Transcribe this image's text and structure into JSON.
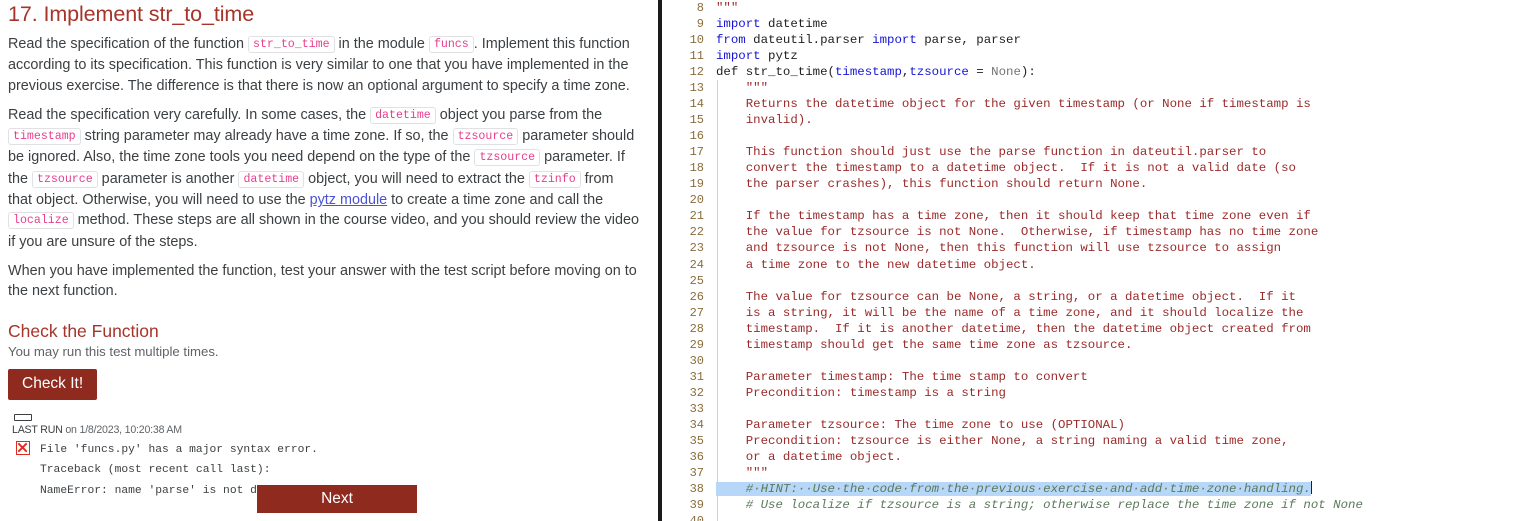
{
  "exercise": {
    "title": "17. Implement str_to_time",
    "paragraphs": [
      {
        "id": "p1",
        "runs": [
          {
            "t": "text",
            "v": "Read the specification of the function "
          },
          {
            "t": "code",
            "v": "str_to_time"
          },
          {
            "t": "text",
            "v": " in the module "
          },
          {
            "t": "code",
            "v": "funcs"
          },
          {
            "t": "text",
            "v": ". Implement this function according to its specification. This function is very similar to one that you have implemented in the previous exercise. The difference is that there is now an optional argument to specify a time zone."
          }
        ]
      },
      {
        "id": "p2",
        "runs": [
          {
            "t": "text",
            "v": "Read the specification very carefully. In some cases, the "
          },
          {
            "t": "code",
            "v": "datetime"
          },
          {
            "t": "text",
            "v": " object you parse from the "
          },
          {
            "t": "code",
            "v": "timestamp"
          },
          {
            "t": "text",
            "v": " string parameter may already have a time zone. If so, the "
          },
          {
            "t": "code",
            "v": "tzsource"
          },
          {
            "t": "text",
            "v": " parameter should be ignored. Also, the time zone tools you need depend on the type of the "
          },
          {
            "t": "code",
            "v": "tzsource"
          },
          {
            "t": "text",
            "v": " parameter. If the "
          },
          {
            "t": "code",
            "v": "tzsource"
          },
          {
            "t": "text",
            "v": " parameter is another "
          },
          {
            "t": "code",
            "v": "datetime"
          },
          {
            "t": "text",
            "v": " object, you will need to extract the "
          },
          {
            "t": "code",
            "v": "tzinfo"
          },
          {
            "t": "text",
            "v": " from that object. Otherwise, you will need to use the "
          },
          {
            "t": "link",
            "v": "pytz module"
          },
          {
            "t": "text",
            "v": " to create a time zone and call the "
          },
          {
            "t": "code",
            "v": "localize"
          },
          {
            "t": "text",
            "v": " method. These steps are all shown in the course video, and you should review the video if you are unsure of the steps."
          }
        ]
      },
      {
        "id": "p3",
        "runs": [
          {
            "t": "text",
            "v": "When you have implemented the function, test your answer with the test script before moving on to the next function."
          }
        ]
      }
    ]
  },
  "check_section": {
    "heading": "Check the Function",
    "subtitle": "You may run this test multiple times.",
    "button_label": "Check It!",
    "last_run_label": "LAST RUN",
    "last_run_on": "on",
    "last_run_timestamp": "1/8/2023, 10:20:38 AM",
    "status_icon": "error-x-icon",
    "result_lines": [
      "File 'funcs.py' has a major syntax error.",
      "Traceback (most recent call last):",
      "NameError: name 'parse' is not defined"
    ]
  },
  "footer": {
    "next_label": "Next"
  },
  "colors": {
    "brand_red": "#a6342a",
    "button_red": "#8f2a1e",
    "link_blue": "#4a52d6",
    "inline_code_pink": "#e83e8c",
    "error_red": "#e02b20",
    "selection_blue": "#b6d7f7",
    "gutter_number": "#8a6d3b",
    "keyword_blue": "#1515d6",
    "docstring_red": "#9b2a2a",
    "comment_green": "#5c7a5c"
  },
  "editor": {
    "first_visible_line": 8,
    "selected_line": 38,
    "lines": [
      {
        "n": 8,
        "indent": false,
        "tokens": [
          {
            "c": "tok-doc",
            "v": "\"\"\""
          }
        ]
      },
      {
        "n": 9,
        "indent": false,
        "tokens": [
          {
            "c": "tok-kw",
            "v": "import"
          },
          {
            "c": "tok-plain",
            "v": " datetime"
          }
        ]
      },
      {
        "n": 10,
        "indent": false,
        "tokens": [
          {
            "c": "tok-kw",
            "v": "from"
          },
          {
            "c": "tok-plain",
            "v": " dateutil.parser "
          },
          {
            "c": "tok-kw",
            "v": "import"
          },
          {
            "c": "tok-plain",
            "v": " parse, parser"
          }
        ]
      },
      {
        "n": 11,
        "indent": false,
        "tokens": [
          {
            "c": "tok-kw",
            "v": "import"
          },
          {
            "c": "tok-plain",
            "v": " pytz"
          }
        ]
      },
      {
        "n": 12,
        "indent": false,
        "tokens": [
          {
            "c": "tok-plain",
            "v": "def str_to_time("
          },
          {
            "c": "tok-var",
            "v": "timestamp"
          },
          {
            "c": "tok-plain",
            "v": ","
          },
          {
            "c": "tok-var",
            "v": "tzsource"
          },
          {
            "c": "tok-plain",
            "v": " = "
          },
          {
            "c": "tok-none",
            "v": "None"
          },
          {
            "c": "tok-plain",
            "v": "):"
          }
        ]
      },
      {
        "n": 13,
        "indent": true,
        "tokens": [
          {
            "c": "tok-doc",
            "v": "    \"\"\""
          }
        ]
      },
      {
        "n": 14,
        "indent": true,
        "tokens": [
          {
            "c": "tok-doc",
            "v": "    Returns the datetime object for the given timestamp (or None if timestamp is"
          }
        ]
      },
      {
        "n": 15,
        "indent": true,
        "tokens": [
          {
            "c": "tok-doc",
            "v": "    invalid)."
          }
        ]
      },
      {
        "n": 16,
        "indent": true,
        "tokens": [
          {
            "c": "tok-doc",
            "v": ""
          }
        ]
      },
      {
        "n": 17,
        "indent": true,
        "tokens": [
          {
            "c": "tok-doc",
            "v": "    This function should just use the parse function in dateutil.parser to"
          }
        ]
      },
      {
        "n": 18,
        "indent": true,
        "tokens": [
          {
            "c": "tok-doc",
            "v": "    convert the timestamp to a datetime object.  If it is not a valid date (so"
          }
        ]
      },
      {
        "n": 19,
        "indent": true,
        "tokens": [
          {
            "c": "tok-doc",
            "v": "    the parser crashes), this function should return None."
          }
        ]
      },
      {
        "n": 20,
        "indent": true,
        "tokens": [
          {
            "c": "tok-doc",
            "v": ""
          }
        ]
      },
      {
        "n": 21,
        "indent": true,
        "tokens": [
          {
            "c": "tok-doc",
            "v": "    If the timestamp has a time zone, then it should keep that time zone even if"
          }
        ]
      },
      {
        "n": 22,
        "indent": true,
        "tokens": [
          {
            "c": "tok-doc",
            "v": "    the value for tzsource is not None.  Otherwise, if timestamp has no time zone"
          }
        ]
      },
      {
        "n": 23,
        "indent": true,
        "tokens": [
          {
            "c": "tok-doc",
            "v": "    and tzsource is not None, then this function will use tzsource to assign"
          }
        ]
      },
      {
        "n": 24,
        "indent": true,
        "tokens": [
          {
            "c": "tok-doc",
            "v": "    a time zone to the new datetime object."
          }
        ]
      },
      {
        "n": 25,
        "indent": true,
        "tokens": [
          {
            "c": "tok-doc",
            "v": ""
          }
        ]
      },
      {
        "n": 26,
        "indent": true,
        "tokens": [
          {
            "c": "tok-doc",
            "v": "    The value for tzsource can be None, a string, or a datetime object.  If it"
          }
        ]
      },
      {
        "n": 27,
        "indent": true,
        "tokens": [
          {
            "c": "tok-doc",
            "v": "    is a string, it will be the name of a time zone, and it should localize the"
          }
        ]
      },
      {
        "n": 28,
        "indent": true,
        "tokens": [
          {
            "c": "tok-doc",
            "v": "    timestamp.  If it is another datetime, then the datetime object created from"
          }
        ]
      },
      {
        "n": 29,
        "indent": true,
        "tokens": [
          {
            "c": "tok-doc",
            "v": "    timestamp should get the same time zone as tzsource."
          }
        ]
      },
      {
        "n": 30,
        "indent": true,
        "tokens": [
          {
            "c": "tok-doc",
            "v": ""
          }
        ]
      },
      {
        "n": 31,
        "indent": true,
        "tokens": [
          {
            "c": "tok-doc",
            "v": "    Parameter timestamp: The time stamp to convert"
          }
        ]
      },
      {
        "n": 32,
        "indent": true,
        "tokens": [
          {
            "c": "tok-doc",
            "v": "    Precondition: timestamp is a string"
          }
        ]
      },
      {
        "n": 33,
        "indent": true,
        "tokens": [
          {
            "c": "tok-doc",
            "v": ""
          }
        ]
      },
      {
        "n": 34,
        "indent": true,
        "tokens": [
          {
            "c": "tok-doc",
            "v": "    Parameter tzsource: The time zone to use (OPTIONAL)"
          }
        ]
      },
      {
        "n": 35,
        "indent": true,
        "tokens": [
          {
            "c": "tok-doc",
            "v": "    Precondition: tzsource is either None, a string naming a valid time zone,"
          }
        ]
      },
      {
        "n": 36,
        "indent": true,
        "tokens": [
          {
            "c": "tok-doc",
            "v": "    or a datetime object."
          }
        ]
      },
      {
        "n": 37,
        "indent": true,
        "tokens": [
          {
            "c": "tok-doc",
            "v": "    \"\"\""
          }
        ]
      },
      {
        "n": 38,
        "indent": true,
        "selected": true,
        "caret": true,
        "tokens": [
          {
            "c": "tok-com",
            "v": "    #·HINT:··Use·the·code·from·the·previous·exercise·and·add·time·zone·handling."
          }
        ]
      },
      {
        "n": 39,
        "indent": true,
        "tokens": [
          {
            "c": "tok-com",
            "v": "    # Use localize if tzsource is a string; otherwise replace the time zone if not None"
          }
        ]
      },
      {
        "n": 40,
        "indent": true,
        "tokens": [
          {
            "c": "tok-plain",
            "v": ""
          }
        ]
      }
    ]
  }
}
